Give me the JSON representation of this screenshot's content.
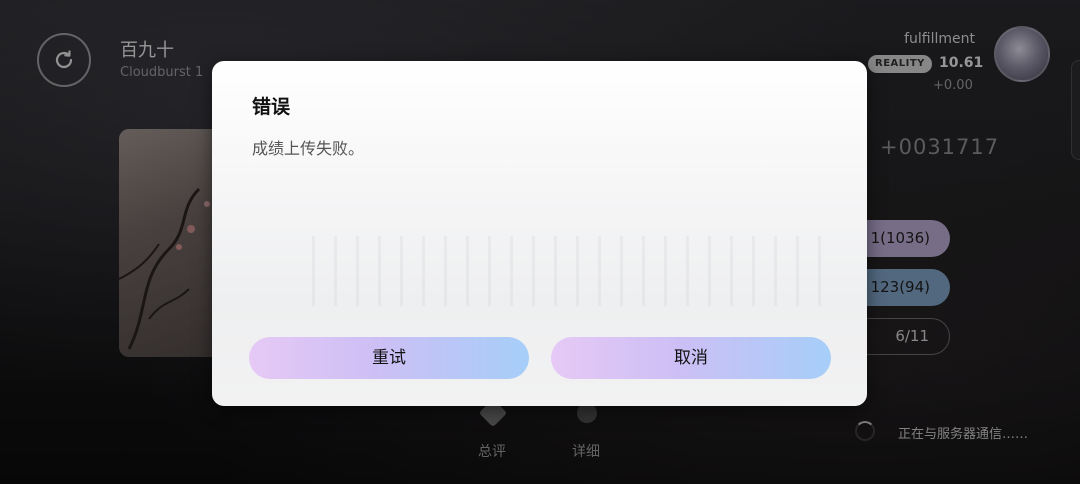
{
  "song": {
    "title": "百九十",
    "subtitle": "Cloudburst 1"
  },
  "player": {
    "name": "fulfillment",
    "badge": "REALITY",
    "rks": "10.61",
    "rks_delta": "+0.00"
  },
  "result": {
    "score": "+0031717",
    "stat_1": "1(1036)",
    "stat_2": "123(94)",
    "stat_3": "6/11"
  },
  "tabs": [
    {
      "label": "总评"
    },
    {
      "label": "详细"
    }
  ],
  "status": {
    "server": "正在与服务器通信……"
  },
  "dialog": {
    "title": "错误",
    "message": "成绩上传失败。",
    "retry_label": "重试",
    "cancel_label": "取消"
  },
  "colors": {
    "button_gradient_start": "#e6c9f5",
    "button_gradient_end": "#a6cef9",
    "stat_1_color": "#b7a8cf",
    "stat_2_color": "#7fa0c3"
  },
  "icons": {
    "retry": "retry-icon",
    "avatar": "avatar",
    "spinner": "loading-spinner-icon"
  }
}
